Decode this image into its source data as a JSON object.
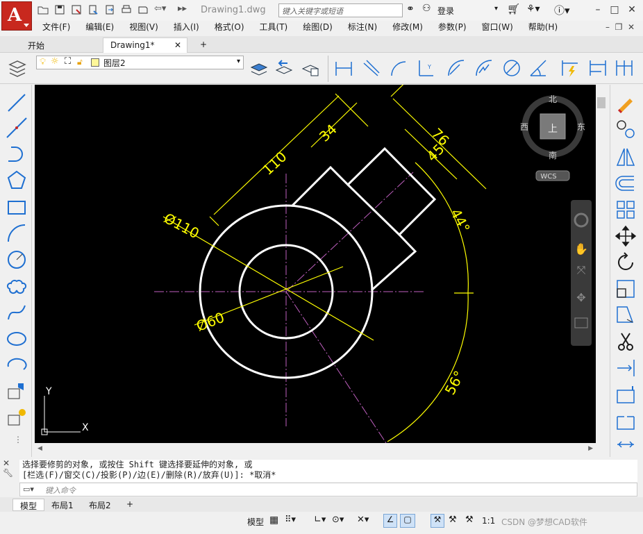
{
  "app": {
    "title": "Drawing1.dwg"
  },
  "search": {
    "placeholder": "键入关键字或短语"
  },
  "account": {
    "login": "登录"
  },
  "menu": [
    "文件(F)",
    "编辑(E)",
    "视图(V)",
    "插入(I)",
    "格式(O)",
    "工具(T)",
    "绘图(D)",
    "标注(N)",
    "修改(M)",
    "参数(P)",
    "窗口(W)",
    "帮助(H)"
  ],
  "tabs": {
    "start": "开始",
    "drawing": "Drawing1*",
    "add": "+"
  },
  "layer": {
    "current": "图层2"
  },
  "viewcube": {
    "north": "北",
    "south": "南",
    "east": "东",
    "west": "西",
    "face": "上",
    "wcs": "WCS"
  },
  "drawing": {
    "dim_110": "110",
    "dim_34": "34",
    "dim_76": "76",
    "dim_45": "45",
    "dim_44": "44°",
    "dim_56": "56°",
    "dia_110": "Ø110",
    "dia_60": "Ø60"
  },
  "ucs": {
    "x": "X",
    "y": "Y"
  },
  "command": {
    "line1": "选择要修剪的对象, 或按住 Shift 键选择要延伸的对象, 或",
    "line2": "[栏选(F)/窗交(C)/投影(P)/边(E)/删除(R)/放弃(U)]:  *取消*",
    "placeholder": "键入命令"
  },
  "layouts": [
    "模型",
    "布局1",
    "布局2"
  ],
  "status": {
    "model": "模型",
    "scale": "1:1",
    "watermark": "CSDN @梦想CAD软件"
  },
  "colors": {
    "dim": "#ffff00",
    "center": "#c060c0",
    "object": "#ffffff",
    "accent": "#1e6fd1"
  }
}
